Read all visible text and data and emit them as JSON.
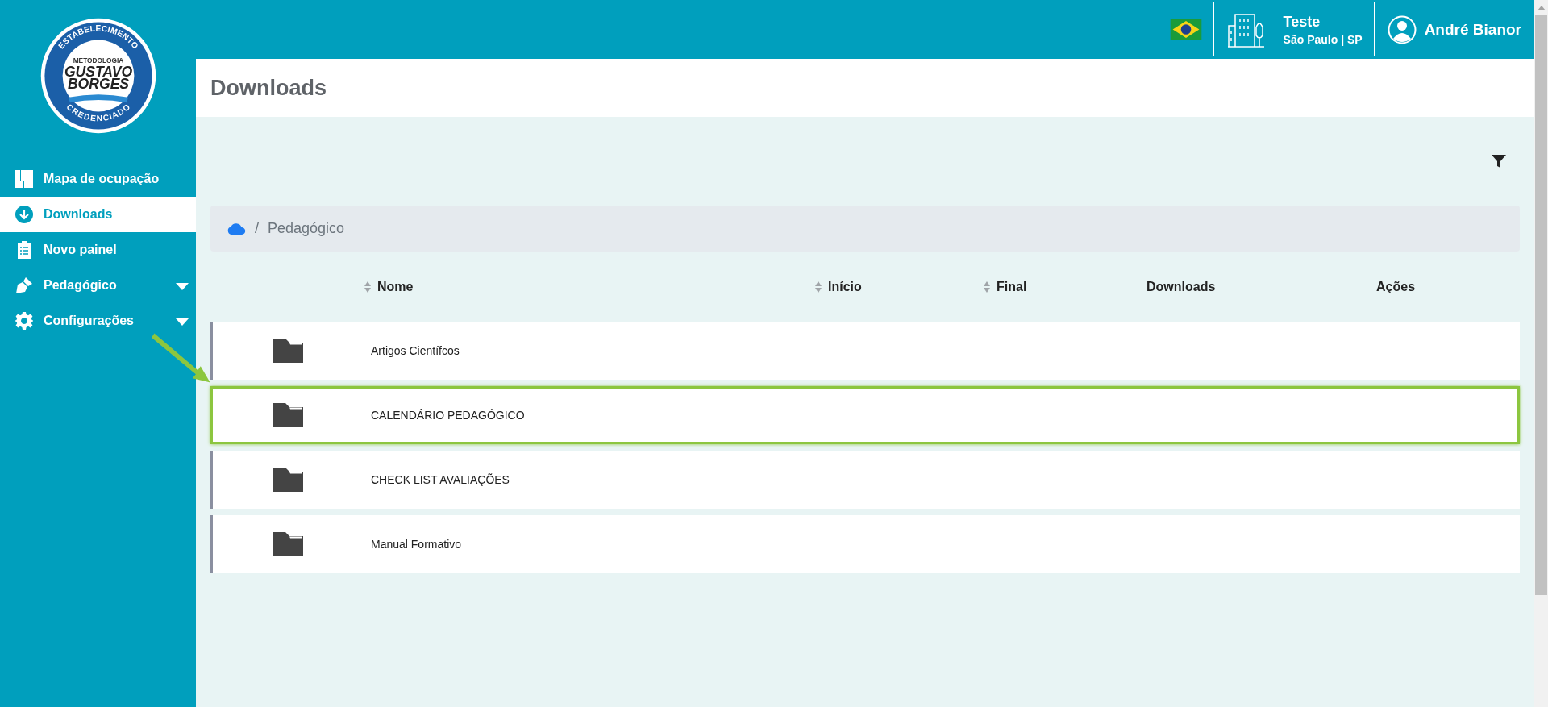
{
  "logo": {
    "top_arc": "ESTABELECIMENTO",
    "tagline": "METODOLOGIA",
    "line_1": "GUSTAVO",
    "line_2": "BORGES",
    "bottom_arc": "CREDENCIADO"
  },
  "sidebar": {
    "items": [
      {
        "kind": "grid",
        "label": "Mapa de ocupação",
        "selected": false,
        "expandable": false
      },
      {
        "kind": "download",
        "label": "Downloads",
        "selected": true,
        "expandable": false
      },
      {
        "kind": "clipboard",
        "label": "Novo painel",
        "selected": false,
        "expandable": false
      },
      {
        "kind": "pen",
        "label": "Pedagógico",
        "selected": false,
        "expandable": true
      },
      {
        "kind": "gear",
        "label": "Configurações",
        "selected": false,
        "expandable": true
      }
    ]
  },
  "header": {
    "unit": {
      "name": "Teste",
      "location": "São Paulo | SP"
    },
    "user": {
      "name": "André Bianor"
    }
  },
  "page_title": "Downloads",
  "breadcrumb": {
    "separator": "/",
    "items": [
      "Pedagógico"
    ]
  },
  "table": {
    "columns": [
      {
        "label": "Nome",
        "sortable": true
      },
      {
        "label": "Início",
        "sortable": true
      },
      {
        "label": "Final",
        "sortable": true
      },
      {
        "label": "Downloads",
        "sortable": false
      },
      {
        "label": "Ações",
        "sortable": false
      }
    ],
    "rows": [
      {
        "name": "Artigos Científcos",
        "highlighted": false
      },
      {
        "name": "CALENDÁRIO PEDAGÓGICO",
        "highlighted": true
      },
      {
        "name": "CHECK LIST AVALIAÇÕES",
        "highlighted": false
      },
      {
        "name": "Manual Formativo",
        "highlighted": false
      }
    ]
  }
}
